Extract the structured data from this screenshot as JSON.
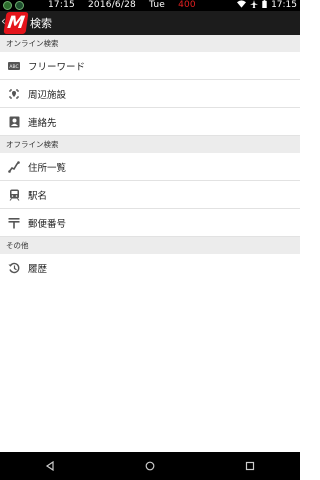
{
  "status_bar": {
    "time_left": "17:15",
    "date": "2016/6/28",
    "day": "Tue",
    "red_value": "400",
    "time_right": "17:15"
  },
  "app_bar": {
    "logo_letter": "M",
    "title": "検索"
  },
  "sections": [
    {
      "header": "オンライン検索",
      "items": [
        {
          "label": "フリーワード",
          "icon": "abc-keyboard-icon"
        },
        {
          "label": "周辺施設",
          "icon": "nearby-pin-icon"
        },
        {
          "label": "連絡先",
          "icon": "contacts-icon"
        }
      ]
    },
    {
      "header": "オフライン検索",
      "items": [
        {
          "label": "住所一覧",
          "icon": "route-icon"
        },
        {
          "label": "駅名",
          "icon": "train-icon"
        },
        {
          "label": "郵便番号",
          "icon": "postal-icon"
        }
      ]
    },
    {
      "header": "その他",
      "items": [
        {
          "label": "履歴",
          "icon": "history-icon"
        }
      ]
    }
  ],
  "colors": {
    "brand_red": "#e4141b",
    "appbar": "#1c1c1c",
    "section_bg": "#ececec"
  }
}
